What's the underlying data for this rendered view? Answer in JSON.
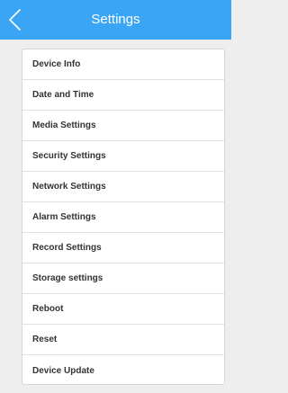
{
  "header": {
    "title": "Settings",
    "back_icon": "chevron-left-icon",
    "color": "#3aa5f4"
  },
  "settings": {
    "items": [
      {
        "label": "Device Info"
      },
      {
        "label": "Date and Time"
      },
      {
        "label": "Media Settings"
      },
      {
        "label": "Security Settings"
      },
      {
        "label": "Network Settings"
      },
      {
        "label": "Alarm Settings"
      },
      {
        "label": "Record Settings"
      },
      {
        "label": "Storage settings"
      },
      {
        "label": "Reboot"
      },
      {
        "label": "Reset"
      },
      {
        "label": "Device Update"
      }
    ]
  }
}
